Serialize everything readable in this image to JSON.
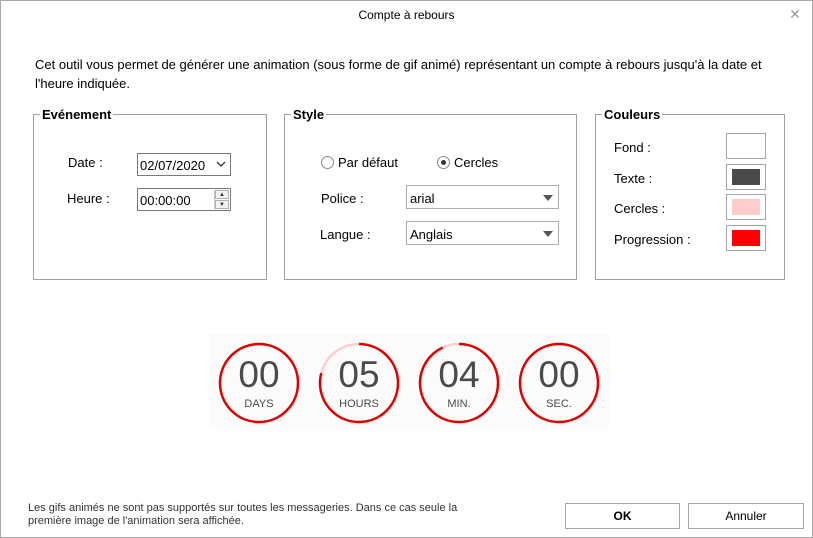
{
  "window": {
    "title": "Compte à rebours",
    "close_glyph": "✕"
  },
  "intro": "Cet outil vous permet de générer une animation (sous forme de gif animé) représentant un compte à rebours jusqu'à la date et l'heure indiquée.",
  "evenement": {
    "legend": "Evénement",
    "date_label": "Date :",
    "date_value": "02/07/2020",
    "time_label": "Heure :",
    "time_value": "00:00:00"
  },
  "style": {
    "legend": "Style",
    "radio_default": "Par défaut",
    "radio_circles": "Cercles",
    "selected": "Cercles",
    "font_label": "Police :",
    "font_value": "arial",
    "lang_label": "Langue :",
    "lang_value": "Anglais"
  },
  "couleurs": {
    "legend": "Couleurs",
    "items": [
      {
        "label": "Fond :",
        "color": "#ffffff"
      },
      {
        "label": "Texte :",
        "color": "#4a4a4a"
      },
      {
        "label": "Cercles :",
        "color": "#ffcccc"
      },
      {
        "label": "Progression :",
        "color": "#ff0000"
      }
    ]
  },
  "preview": {
    "ring_color": "#ffcccc",
    "progress_color": "#e00000",
    "units": [
      {
        "value": "00",
        "unit": "DAYS",
        "progress": 1.0
      },
      {
        "value": "05",
        "unit": "HOURS",
        "progress": 0.79
      },
      {
        "value": "04",
        "unit": "MIN.",
        "progress": 0.93
      },
      {
        "value": "00",
        "unit": "SEC.",
        "progress": 1.0
      }
    ]
  },
  "footnote": "Les gifs animés ne sont pas supportés sur toutes les messageries. Dans ce cas seule la première image de l'animation sera affichée.",
  "buttons": {
    "ok": "OK",
    "cancel": "Annuler"
  }
}
